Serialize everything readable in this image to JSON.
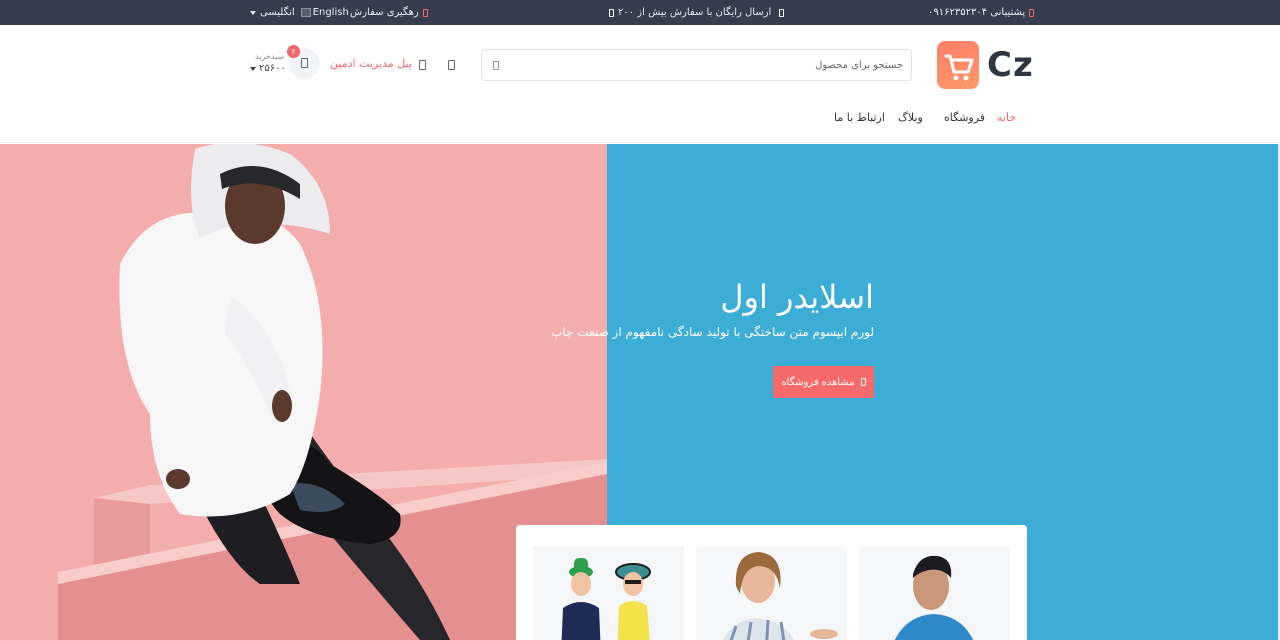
{
  "topbar": {
    "support_label": "پشتیبانی ۰۹۱۶۲۳۵۲۳۰۴",
    "free_shipping": "ارسال رایگان با سفارش بیش از ۲۰۰",
    "track_order": "رهگیری سفارش",
    "language_selected": "انگلیسی",
    "language_flag_alt": "English"
  },
  "header": {
    "logo_text": "Cz",
    "search_placeholder": "جستجو برای محصول",
    "admin_panel": "پنل مدیریت ادمین",
    "cart_badge": "۴",
    "cart_label": "سبدخرید",
    "cart_total": "۲۵۶۰۰"
  },
  "nav": {
    "home": "خانه",
    "shop": "فروشگاه",
    "blog": "وبلاگ",
    "contact": "ارتباط با ما"
  },
  "slider": {
    "title": "اسلایدر اول",
    "subtitle": "لورم ایپسوم متن ساختگی با تولید سادگی نامفهوم از صنعت چاپ",
    "button": "مشاهده فروشگاه"
  },
  "colors": {
    "topbar_bg": "#363e4d",
    "accent": "#f0676b",
    "hero_left": "#f4adad",
    "hero_right": "#3badd6"
  }
}
